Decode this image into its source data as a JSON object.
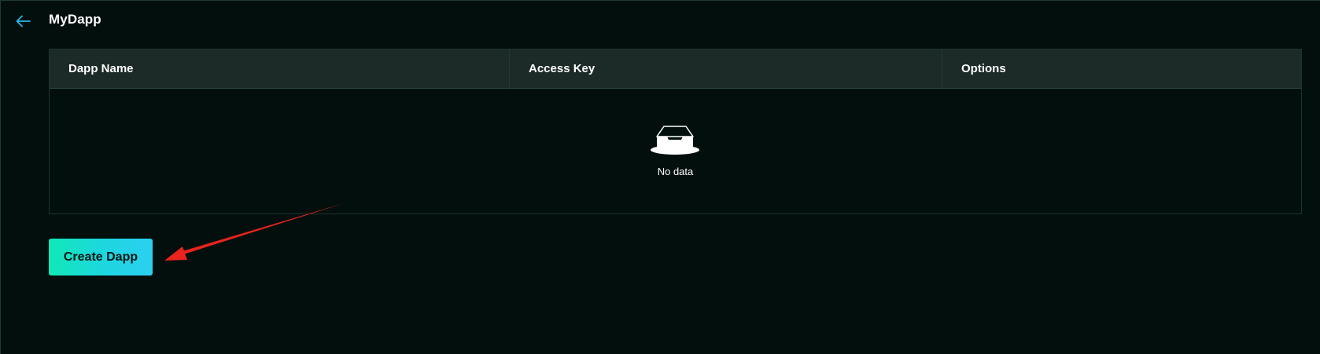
{
  "header": {
    "back_icon": "arrow-left-icon",
    "title": "MyDapp"
  },
  "table": {
    "columns": [
      "Dapp Name",
      "Access Key",
      "Options"
    ],
    "rows": [],
    "empty_icon": "empty-inbox-icon",
    "empty_text": "No data"
  },
  "actions": {
    "create_label": "Create Dapp"
  },
  "colors": {
    "background": "#020f0d",
    "table_header": "#1c2b28",
    "back_icon": "#29b6e8",
    "button_gradient_start": "#10e8b8",
    "button_gradient_end": "#2bd0f0",
    "annotation_arrow": "#e8241d"
  }
}
